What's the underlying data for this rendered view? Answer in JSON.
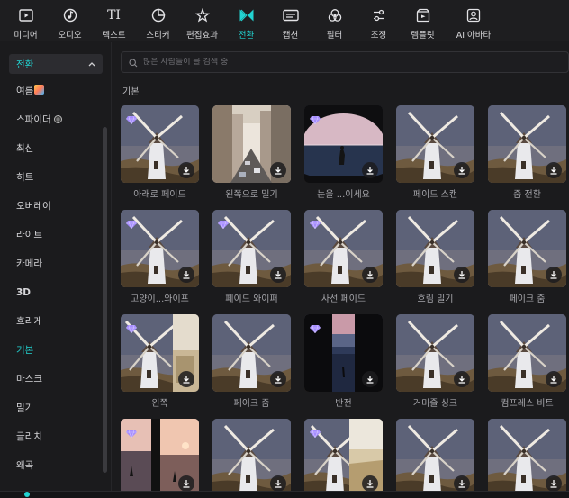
{
  "toolbar": {
    "items": [
      {
        "label": "미디어",
        "icon": "media-icon"
      },
      {
        "label": "오디오",
        "icon": "audio-icon"
      },
      {
        "label": "텍스트",
        "icon": "text-icon"
      },
      {
        "label": "스티커",
        "icon": "sticker-icon"
      },
      {
        "label": "편집효과",
        "icon": "effects-icon"
      },
      {
        "label": "전환",
        "icon": "transition-icon",
        "active": true
      },
      {
        "label": "캡션",
        "icon": "caption-icon"
      },
      {
        "label": "필터",
        "icon": "filter-icon"
      },
      {
        "label": "조정",
        "icon": "adjust-icon"
      },
      {
        "label": "템플릿",
        "icon": "template-icon"
      },
      {
        "label": "AI 아바타",
        "icon": "ai-avatar-icon"
      }
    ],
    "text_icon_glyph": "TI"
  },
  "sidebar": {
    "header": "전환",
    "items": [
      {
        "label": "여름"
      },
      {
        "label": "스파이더"
      },
      {
        "label": "최신"
      },
      {
        "label": "히트"
      },
      {
        "label": "오버레이"
      },
      {
        "label": "라이트"
      },
      {
        "label": "카메라"
      },
      {
        "label": "3D"
      },
      {
        "label": "흐리게"
      },
      {
        "label": "기본",
        "active": true
      },
      {
        "label": "마스크"
      },
      {
        "label": "밀기"
      },
      {
        "label": "글리치"
      },
      {
        "label": "왜곡"
      }
    ]
  },
  "search": {
    "placeholder": "많은 사람들이 를 검색 중"
  },
  "section": {
    "title": "기본"
  },
  "cards": [
    {
      "label": "아래로 페이드",
      "thumb": "windmill",
      "premium": true
    },
    {
      "label": "왼쪽으로 밀기",
      "thumb": "city",
      "premium": false
    },
    {
      "label": "눈을 ...이세요",
      "thumb": "eye",
      "premium": true
    },
    {
      "label": "페이드 스캔",
      "thumb": "windmill",
      "premium": false
    },
    {
      "label": "줌 전환",
      "thumb": "windmill",
      "premium": false
    },
    {
      "label": "고양이...와이프",
      "thumb": "windmill",
      "premium": true
    },
    {
      "label": "페이드 와이퍼",
      "thumb": "windmill",
      "premium": true
    },
    {
      "label": "사선 페이드",
      "thumb": "windmill",
      "premium": true
    },
    {
      "label": "흐림 밀기",
      "thumb": "windmill",
      "premium": false
    },
    {
      "label": "페이크 줌",
      "thumb": "windmill",
      "premium": false
    },
    {
      "label": "왼쪽",
      "thumb": "split-left",
      "premium": true
    },
    {
      "label": "페이크 줌",
      "thumb": "windmill",
      "premium": false
    },
    {
      "label": "반전",
      "thumb": "reverse",
      "premium": true
    },
    {
      "label": "거미줄 싱크",
      "thumb": "windmill",
      "premium": false
    },
    {
      "label": "컴프레스 비트",
      "thumb": "windmill",
      "premium": false
    },
    {
      "label": "",
      "thumb": "sunset-split",
      "premium": true
    },
    {
      "label": "",
      "thumb": "windmill",
      "premium": false
    },
    {
      "label": "",
      "thumb": "windmill-beach",
      "premium": true
    },
    {
      "label": "",
      "thumb": "windmill",
      "premium": false
    },
    {
      "label": "",
      "thumb": "windmill",
      "premium": false
    }
  ],
  "colors": {
    "accent": "#22d3d1",
    "premium_gem": "#a58cff",
    "background": "#1b1b1d"
  }
}
